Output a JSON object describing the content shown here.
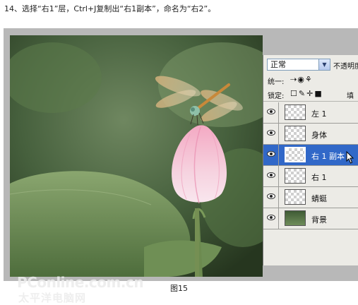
{
  "instruction": "14、选择“右1”层，Ctrl+J复制出“右1副本”，命名为“右2”。",
  "caption": "图15",
  "watermark": {
    "line1": "PConline.com.cn",
    "line2": "太平洋电脑网"
  },
  "layers_panel": {
    "blend_mode": "正常",
    "opacity_label": "不透明度",
    "unify_label": "统一:",
    "lock_label": "锁定:",
    "fill_label": "填",
    "layers": [
      {
        "name": "左 1",
        "selected": false,
        "type": "transparent"
      },
      {
        "name": "身体",
        "selected": false,
        "type": "transparent"
      },
      {
        "name": "右 1 副本",
        "selected": true,
        "type": "transparent"
      },
      {
        "name": "右 1",
        "selected": false,
        "type": "transparent"
      },
      {
        "name": "蜻蜓",
        "selected": false,
        "type": "transparent"
      },
      {
        "name": "背景",
        "selected": false,
        "type": "image"
      }
    ]
  },
  "colors": {
    "selection": "#3168c8",
    "panel_bg": "#ecebe6",
    "frame": "#b8b8b8"
  }
}
